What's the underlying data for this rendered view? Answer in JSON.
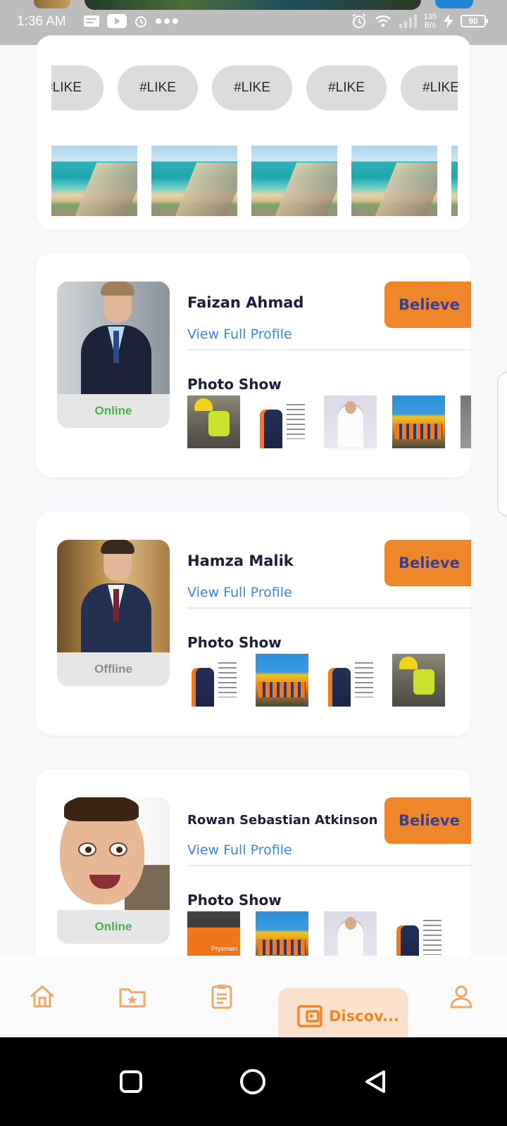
{
  "status_bar": {
    "time": "1:36 AM",
    "left_icons": [
      "notes-icon",
      "youtube-icon",
      "alarm-icon",
      "more-dots-icon"
    ],
    "right_icons": [
      "alarm-icon",
      "wifi-icon",
      "signal-icon",
      "charging-icon"
    ],
    "speed_value": "135",
    "speed_unit": "B/s",
    "battery": "90"
  },
  "top_card": {
    "chips": [
      "#LIKE",
      "#LIKE",
      "#LIKE",
      "#LIKE",
      "#LIKE"
    ],
    "images_count_visible": 5
  },
  "profiles": [
    {
      "name": "Faizan Ahmad",
      "link": "View Full Profile",
      "button": "Believe",
      "status": "Online",
      "section_title": "Photo Show",
      "photos": [
        "worker-yellow",
        "worker-orange",
        "office",
        "group",
        "partial"
      ]
    },
    {
      "name": "Hamza Malik",
      "link": "View Full Profile",
      "button": "Believe",
      "status": "Offline",
      "section_title": "Photo Show",
      "photos": [
        "worker-orange",
        "group",
        "worker-orange",
        "worker-yellow"
      ]
    },
    {
      "name": "Rowan Sebastian Atkinson",
      "link": "View Full Profile",
      "button": "Believe",
      "status": "Online",
      "section_title": "Photo Show",
      "photos": [
        "prysmian",
        "group",
        "office",
        "worker-orange"
      ]
    }
  ],
  "bottom_nav": {
    "items": [
      "home-icon",
      "folder-star-icon",
      "clipboard-icon",
      "wallet-icon",
      "user-icon"
    ],
    "active_label": "Discov..."
  },
  "colors": {
    "accent": "#f0862a",
    "accent_soft": "#fce1cc",
    "link": "#3b86e6",
    "online": "#4caf50",
    "offline": "#8c8c8c",
    "button_text": "#3c3f8f"
  }
}
